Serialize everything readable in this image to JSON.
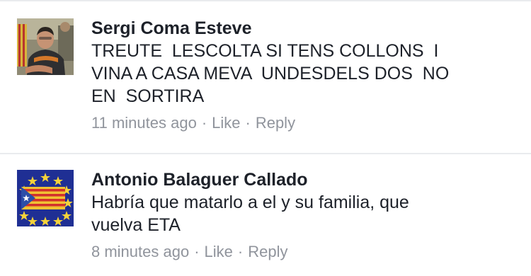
{
  "comments": [
    {
      "author": "Sergi Coma Esteve",
      "text": "TREUTE  LESCOLTA SI TENS COLLONS  I\nVINA A CASA MEVA  UNDESDELS DOS  NO\nEN  SORTIRA",
      "time": "11 minutes ago",
      "like": "Like",
      "reply": "Reply",
      "separator": "·",
      "avatar": "profile-photo-man"
    },
    {
      "author": "Antonio Balaguer Callado",
      "text": "Habría que matarlo a el y su familia, que\nvuelva ETA",
      "time": "8 minutes ago",
      "like": "Like",
      "reply": "Reply",
      "separator": "·",
      "avatar": "estelada-eu-flag"
    }
  ]
}
